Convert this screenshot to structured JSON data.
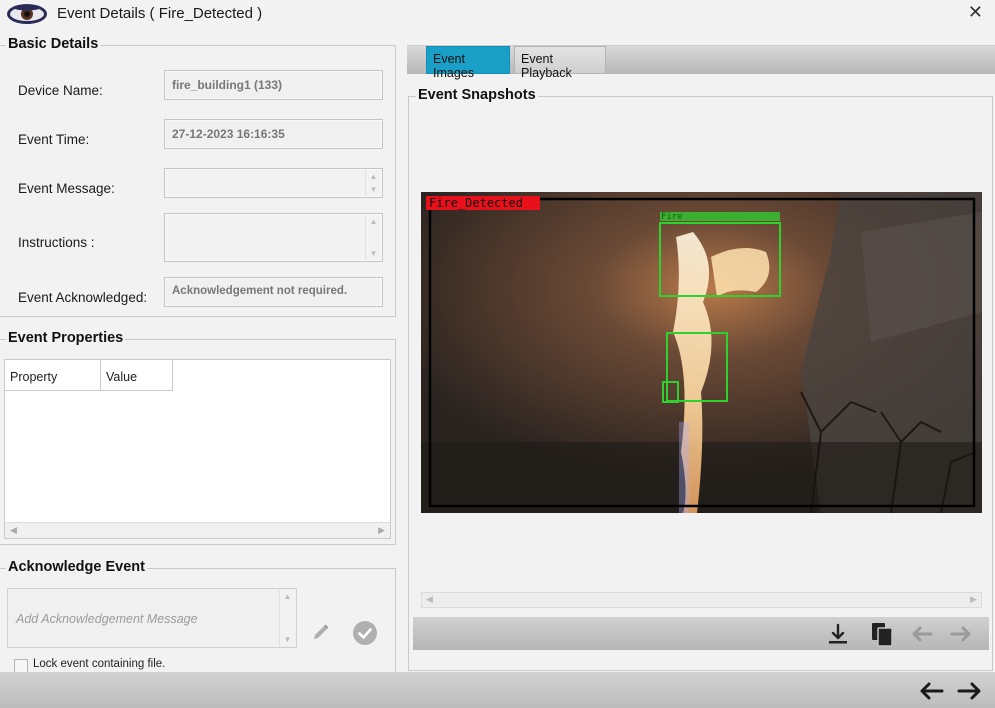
{
  "window": {
    "title": "Event Details ( Fire_Detected )",
    "close_label": "✕"
  },
  "basic_details": {
    "heading": "Basic Details",
    "device_name_label": "Device Name:",
    "device_name_value": "fire_building1 (133)",
    "event_time_label": "Event Time:",
    "event_time_value": "27-12-2023 16:16:35",
    "event_message_label": "Event Message:",
    "event_message_value": "",
    "instructions_label": "Instructions :",
    "instructions_value": "",
    "ack_label": "Event Acknowledged:",
    "ack_value": "Acknowledgement not required."
  },
  "event_properties": {
    "heading": "Event Properties",
    "columns": [
      "Property",
      "Value"
    ]
  },
  "acknowledge": {
    "heading": "Acknowledge Event",
    "placeholder": "Add Acknowledgement Message",
    "lock_label": "Lock event containing file.",
    "lock_checked": false
  },
  "tabs": [
    {
      "label": "Event Images",
      "active": true
    },
    {
      "label": "Event Playback",
      "active": false
    }
  ],
  "snapshots": {
    "heading": "Event Snapshots",
    "overlay_label": "Fire_Detected",
    "box_label": "Fire",
    "overlay_color": "#e8101a",
    "box_color": "#2fd12f"
  },
  "colors": {
    "active_tab": "#1aa0c6"
  }
}
